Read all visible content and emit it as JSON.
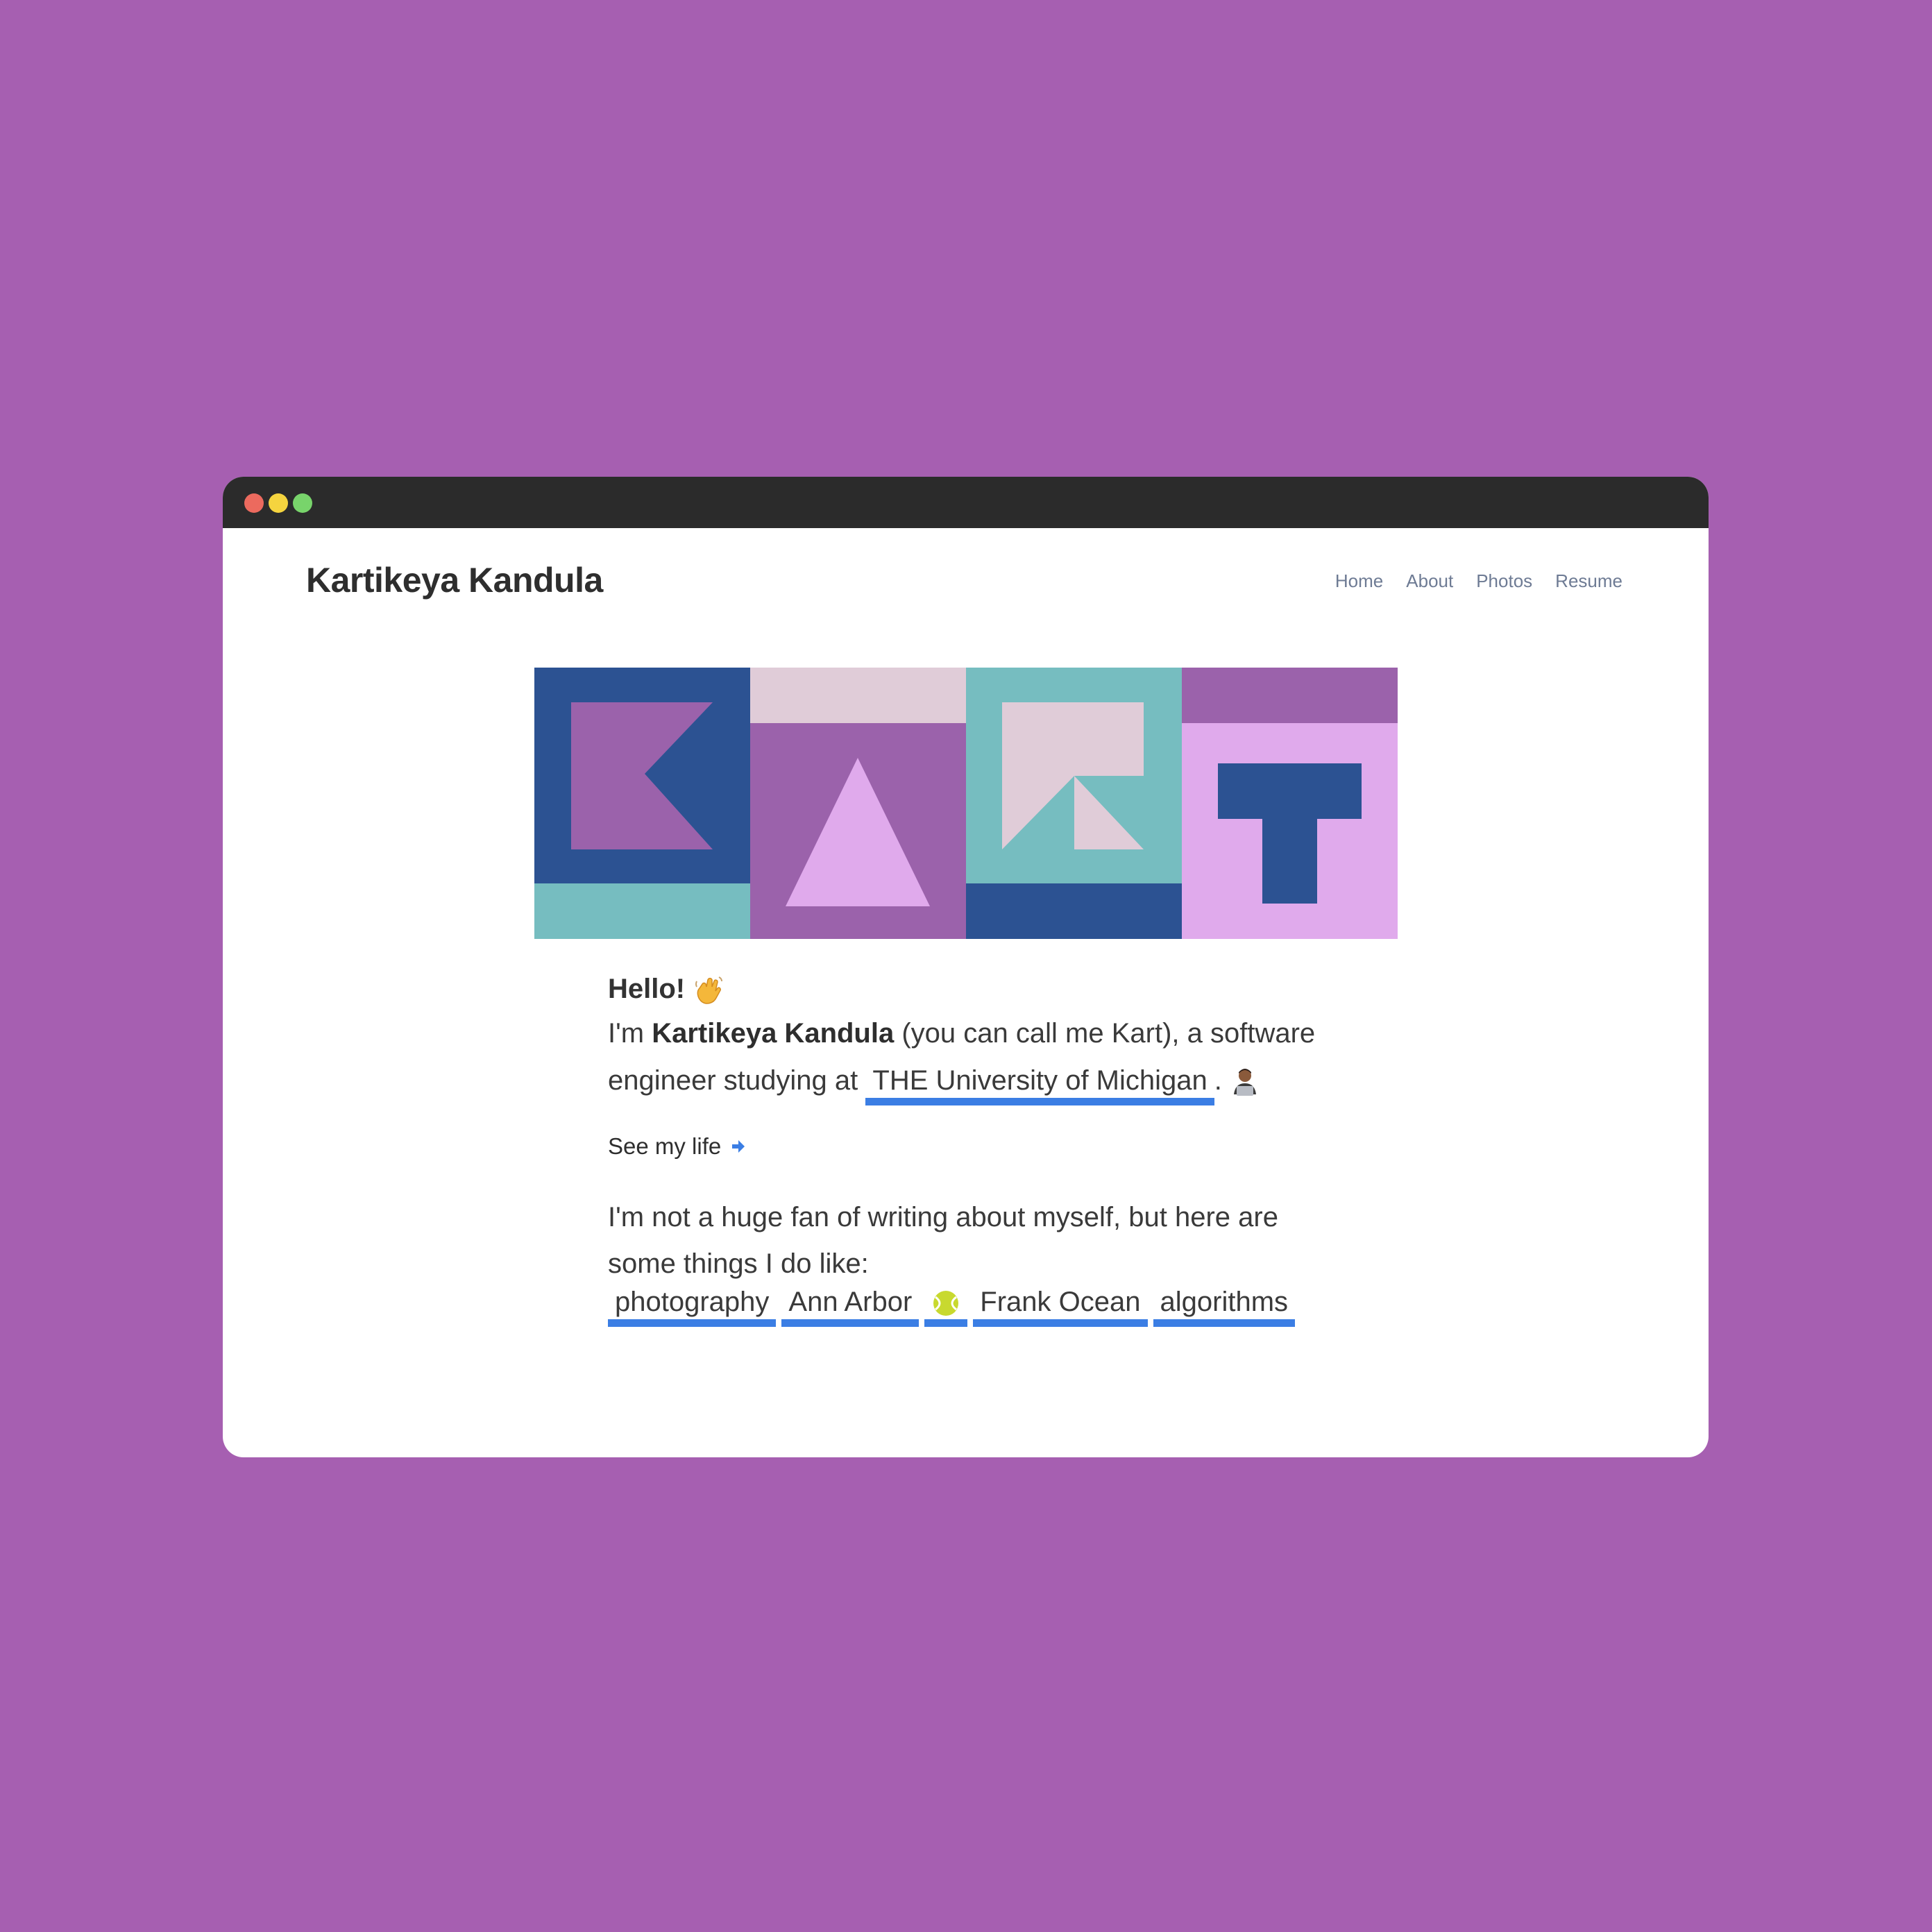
{
  "site": {
    "title": "Kartikeya Kandula"
  },
  "nav": {
    "items": [
      "Home",
      "About",
      "Photos",
      "Resume"
    ]
  },
  "banner": {
    "letters": "KART",
    "colors": {
      "navy": "#2c5292",
      "purple": "#9b62ab",
      "teal": "#76bdc0",
      "light_pink": "#e0ccd8",
      "lilac": "#e0aaec"
    }
  },
  "intro": {
    "hello": "Hello!",
    "im": "I'm",
    "name": "Kartikeya Kandula",
    "rest": "(you can call me Kart), a software engineer studying at",
    "university": "THE University of Michigan",
    "period": "."
  },
  "see_life": {
    "label": "See my life"
  },
  "likes": {
    "text": "I'm not a huge fan of writing about myself, but here are some things I do like:",
    "tags": [
      "photography",
      "Ann Arbor",
      "",
      "Frank Ocean",
      "algorithms"
    ]
  },
  "accent": "#3b7ee4",
  "background": "#a65fb1"
}
